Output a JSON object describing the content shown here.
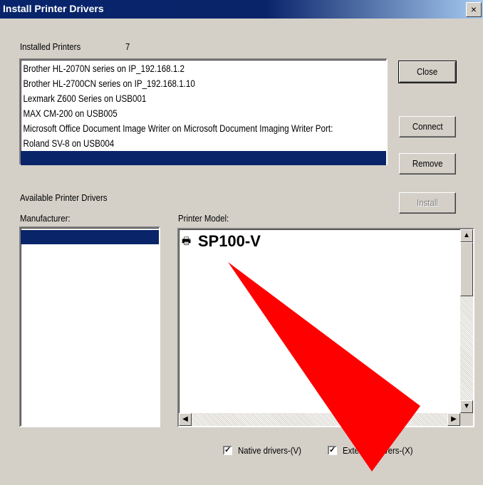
{
  "window": {
    "title": "Install Printer Drivers",
    "close_glyph": "×"
  },
  "installed": {
    "label": "Installed Printers",
    "count": "7",
    "items": [
      "Brother HL-2070N series on IP_192.168.1.2",
      "Brother HL-2700CN series on IP_192.168.1.10",
      "Lexmark Z600 Series on USB001",
      "MAX CM-200 on USB005",
      "Microsoft Office Document Image Writer on Microsoft Document Imaging Writer Port:",
      "Roland SV-8 on USB004"
    ]
  },
  "buttons": {
    "close": "Close",
    "connect": "Connect",
    "remove": "Remove",
    "install": "Install"
  },
  "available": {
    "label": "Available Printer Drivers",
    "manufacturer_label": "Manufacturer:",
    "model_label": "Printer Model:"
  },
  "model_list": {
    "item": "SP100-V",
    "icon": "printer-icon"
  },
  "checkboxes": {
    "native": {
      "label": "Native drivers-(V)",
      "checked": true
    },
    "external": {
      "label": "External drivers-(X)",
      "checked": true
    }
  },
  "overlay": {
    "shape": "red-arrow-annotation",
    "color": "#ff0000"
  }
}
